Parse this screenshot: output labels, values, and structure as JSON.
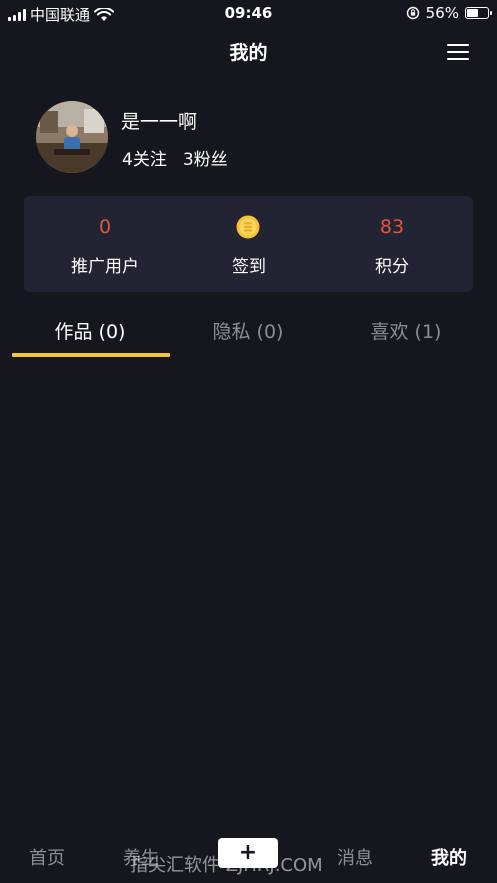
{
  "status_bar": {
    "carrier": "中国联通",
    "time": "09:46",
    "battery_percent": "56%",
    "battery_level": 0.56,
    "icons": [
      "signal-icon",
      "wifi-icon",
      "orientation-lock-icon",
      "battery-icon"
    ]
  },
  "nav": {
    "title": "我的",
    "menu_icon": "hamburger-menu-icon"
  },
  "profile": {
    "username": "是一一啊",
    "following": "4关注",
    "followers": "3粉丝"
  },
  "stats": [
    {
      "value": "0",
      "label": "推广用户"
    },
    {
      "icon": "coin-icon",
      "label": "签到"
    },
    {
      "value": "83",
      "label": "积分"
    }
  ],
  "tabs": [
    {
      "label": "作品 (0)",
      "active": true
    },
    {
      "label": "隐私 (0)",
      "active": false
    },
    {
      "label": "喜欢 (1)",
      "active": false
    }
  ],
  "bottom_nav": {
    "items": [
      {
        "label": "首页",
        "active": false
      },
      {
        "label": "养生",
        "active": false
      },
      {
        "label": "+",
        "active": false
      },
      {
        "label": "消息",
        "active": false
      },
      {
        "label": "我的",
        "active": true
      }
    ],
    "watermark": "指尖汇软件 ZJHRJ.COM"
  },
  "colors": {
    "background": "#16161e",
    "card": "#222433",
    "accent_red": "#e0573b",
    "tab_indicator": "#f6c437",
    "inactive_text": "#8d8d96"
  }
}
